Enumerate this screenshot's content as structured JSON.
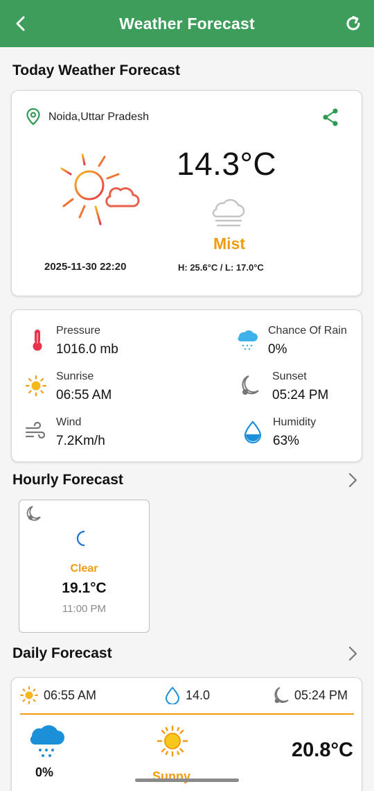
{
  "appbar": {
    "title": "Weather Forecast",
    "back_icon": "chevron-left-icon",
    "refresh_icon": "refresh-icon",
    "color": "#3c9e5a"
  },
  "today": {
    "section_title": "Today Weather Forecast",
    "location": "Noida,Uttar Pradesh",
    "temperature": "14.3°C",
    "condition": "Mist",
    "datetime": "2025-11-30 22:20",
    "high_low": "H: 25.6°C  /  L: 17.0°C",
    "accent": "#f29b11"
  },
  "details": {
    "pressure": {
      "label": "Pressure",
      "value": "1016.0 mb",
      "icon": "thermometer-icon"
    },
    "rain": {
      "label": "Chance Of Rain",
      "value": "0%",
      "icon": "rain-cloud-icon"
    },
    "sunrise": {
      "label": "Sunrise",
      "value": "06:55 AM",
      "icon": "sun-icon"
    },
    "sunset": {
      "label": "Sunset",
      "value": "05:24 PM",
      "icon": "moon-icon"
    },
    "wind": {
      "label": "Wind",
      "value": "7.2Km/h",
      "icon": "wind-icon"
    },
    "humidity": {
      "label": "Humidity",
      "value": "63%",
      "icon": "water-drop-icon"
    }
  },
  "hourly": {
    "section_title": "Hourly Forecast",
    "items": [
      {
        "condition": "Clear",
        "temperature": "19.1°C",
        "time": "11:00 PM"
      }
    ]
  },
  "daily": {
    "section_title": "Daily Forecast",
    "items": [
      {
        "sunrise": "06:55 AM",
        "rain": "14.0",
        "sunset": "05:24 PM",
        "chance": "0%",
        "condition": "Sunny",
        "temperature": "20.8°C"
      }
    ]
  }
}
